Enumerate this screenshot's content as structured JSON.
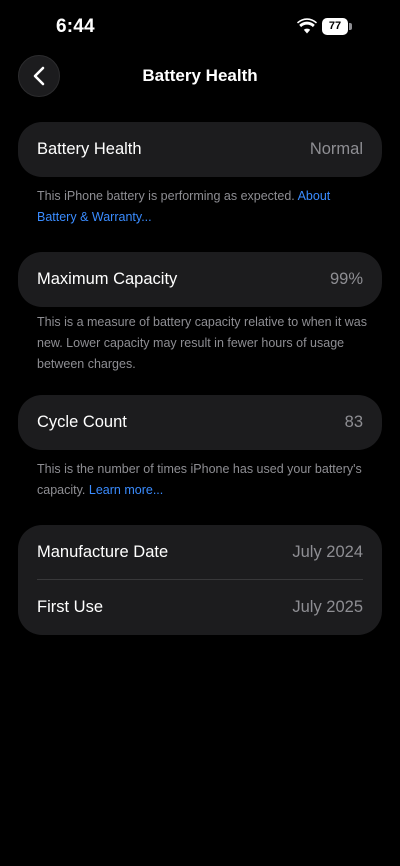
{
  "status_bar": {
    "time": "6:44",
    "battery_level": "77",
    "icons": [
      "wifi-icon",
      "battery-icon"
    ]
  },
  "nav": {
    "back_icon": "chevron-left-icon",
    "title": "Battery Health"
  },
  "battery_health": {
    "label": "Battery Health",
    "value": "Normal",
    "footnote": "This iPhone battery is performing as expected.",
    "link": "About Battery & Warranty..."
  },
  "maximum_capacity": {
    "label": "Maximum Capacity",
    "value": "99%",
    "footnote": "This is a measure of battery capacity relative to when it was new. Lower capacity may result in fewer hours of usage between charges."
  },
  "cycle_count": {
    "label": "Cycle Count",
    "value": "83",
    "footnote": "This is the number of times iPhone has used your battery's capacity.",
    "link": "Learn more..."
  },
  "dates": {
    "manufacture_label": "Manufacture Date",
    "manufacture_value": "July 2024",
    "first_use_label": "First Use",
    "first_use_value": "July 2025"
  },
  "colors": {
    "background": "#000000",
    "card": "#1c1c1e",
    "secondary_text": "#8e8e93",
    "link": "#3a8cff"
  }
}
